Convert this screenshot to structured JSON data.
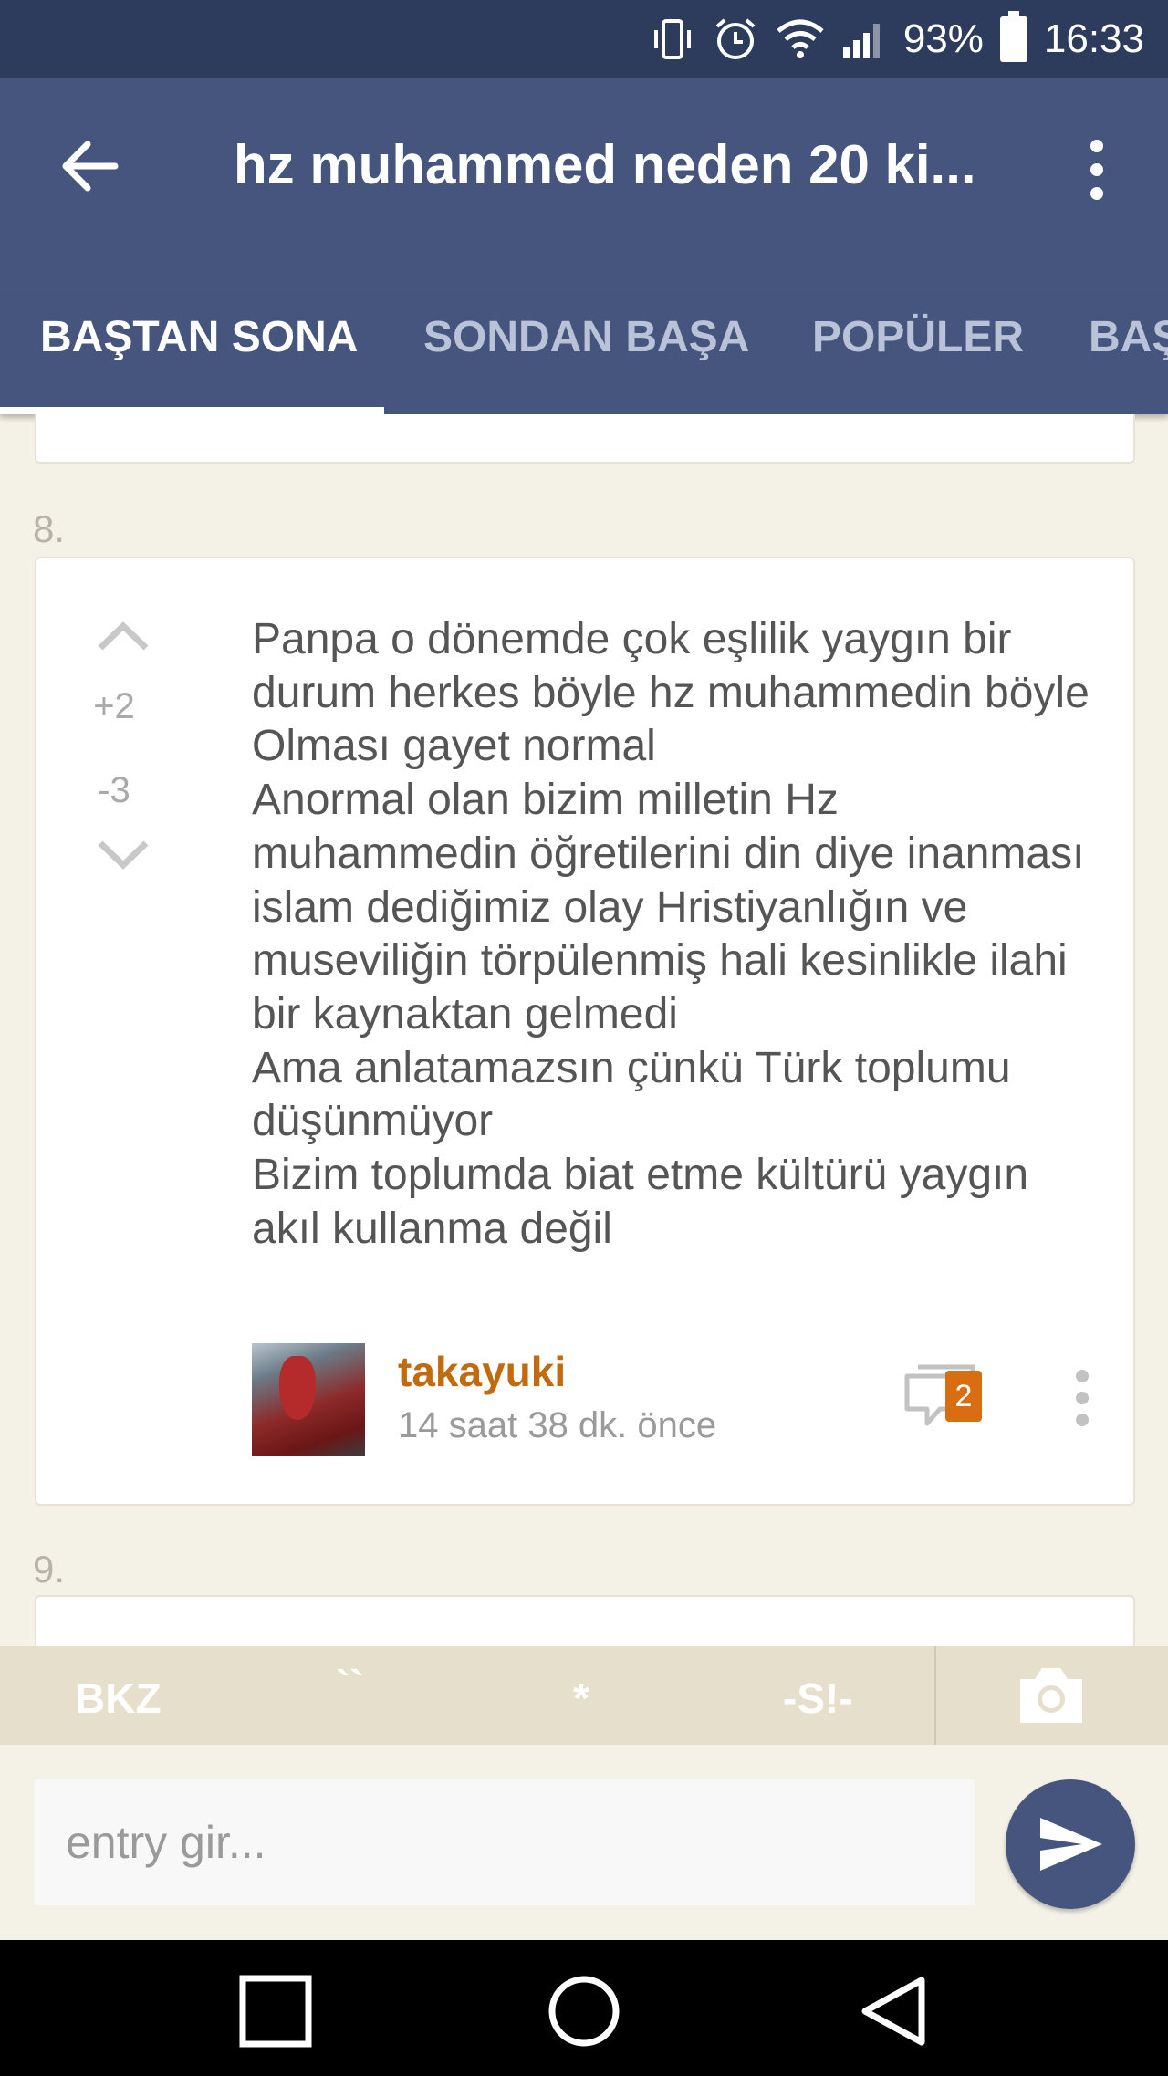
{
  "status_bar": {
    "battery_percent": "93%",
    "time": "16:33"
  },
  "app_bar": {
    "title": "hz muhammed neden 20 ki..."
  },
  "tabs": [
    {
      "label": "BAŞTAN SONA",
      "active": true
    },
    {
      "label": "SONDAN BAŞA",
      "active": false
    },
    {
      "label": "POPÜLER",
      "active": false
    },
    {
      "label": "BAŞ",
      "active": false
    }
  ],
  "entries": [
    {
      "number": "8.",
      "votes_up": "+2",
      "votes_down": "-3",
      "text_lines": [
        "Panpa o dönemde çok eşlilik yaygın bir",
        "durum herkes böyle hz muhammedin böyle",
        "Olması gayet normal",
        "Anormal olan bizim milletin Hz",
        "muhammedin öğretilerini din diye inanması",
        "islam dediğimiz olay Hristiyanlığın ve",
        "museviliğin törpülenmiş hali kesinlikle ilahi",
        "bir kaynaktan gelmedi",
        "Ama anlatamazsın çünkü Türk toplumu",
        "düşünmüyor",
        "Bizim toplumda biat etme kültürü yaygın",
        "akıl kullanma değil"
      ],
      "author": "takayuki",
      "time": "14 saat 38 dk. önce",
      "comment_count": "2"
    },
    {
      "number": "9."
    }
  ],
  "format_bar": {
    "bkz": "BKZ",
    "quote": "``",
    "star": "*",
    "spoiler": "-S!-"
  },
  "input": {
    "placeholder": "entry gir..."
  },
  "colors": {
    "header": "#45557d",
    "status_bar": "#2d3b5c",
    "author": "#c26a0e",
    "badge": "#d86e11",
    "background": "#f4f1e6"
  }
}
